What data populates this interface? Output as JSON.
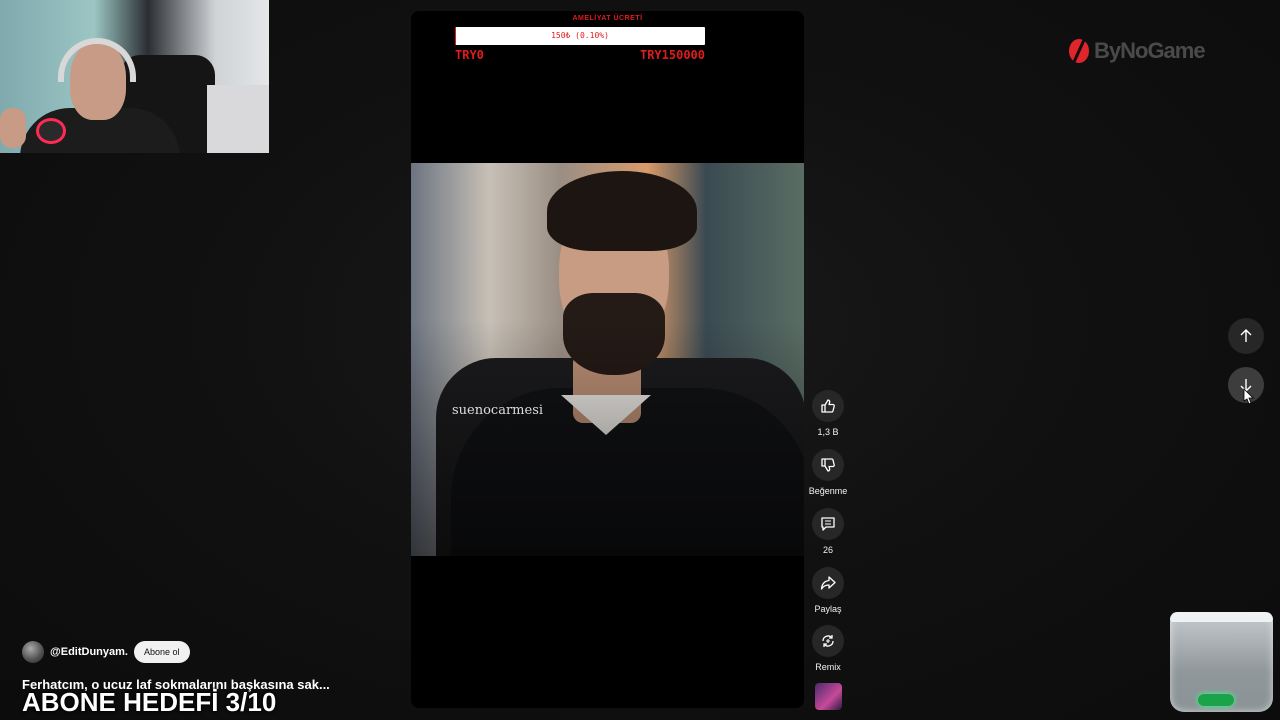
{
  "overlay": {
    "goal_label": "AMELİYAT ÜCRETİ",
    "goal_progress_text": "150₺ (0.10%)",
    "goal_progress_fraction": 0.001,
    "goal_min": "TRY0",
    "goal_max": "TRY150000",
    "subscriber_goal": "ABONE HEDEFİ 3/10"
  },
  "video": {
    "watermark": "suenocarmesi",
    "channel_handle": "@EditDunyam.",
    "subscribe_label": "Abone ol",
    "title": "Ferhatcım, o ucuz laf sokmalarını başkasına sak..."
  },
  "actions": {
    "like_count": "1,3 B",
    "dislike_label": "Beğenme",
    "comment_count": "26",
    "share_label": "Paylaş",
    "remix_label": "Remix"
  },
  "brand": {
    "name": "ByNoGame"
  },
  "colors": {
    "goal_red": "#e01b1b",
    "button_bg": "#272727",
    "brand_red": "#e0262b"
  }
}
